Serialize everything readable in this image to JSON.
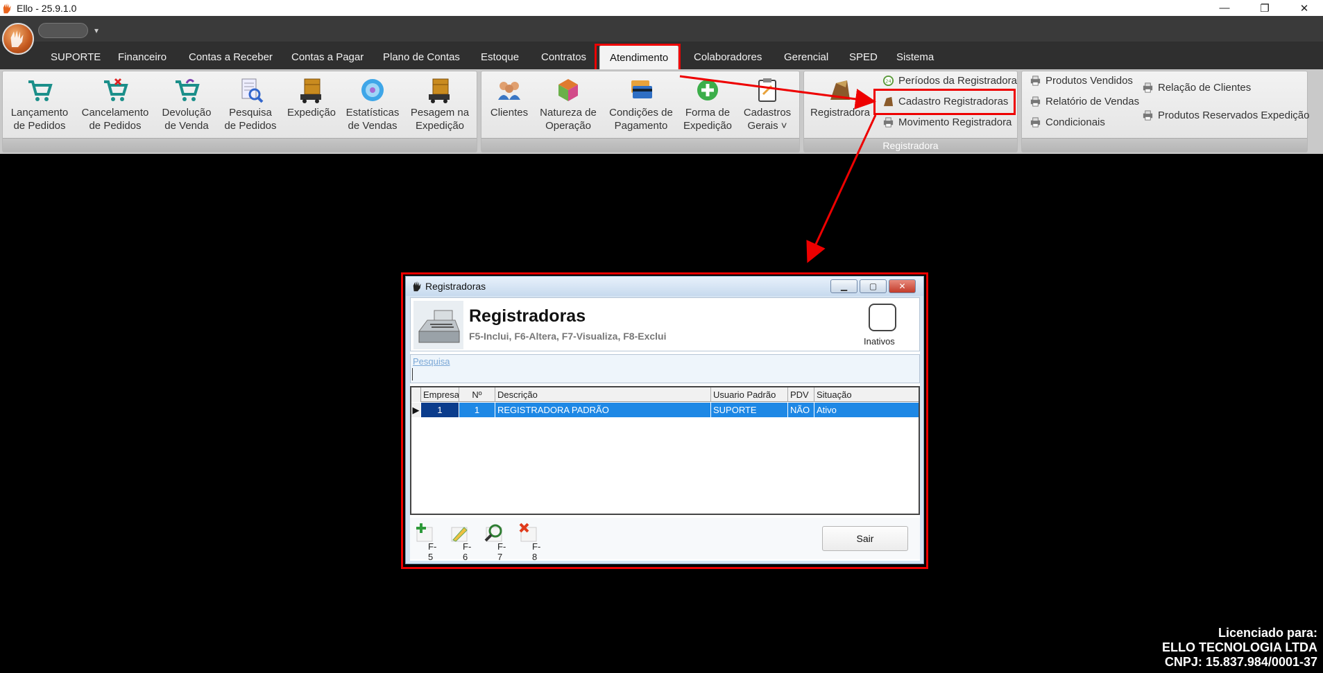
{
  "window": {
    "title": "Ello - 25.9.1.0"
  },
  "tabs": [
    {
      "label": "SUPORTE"
    },
    {
      "label": "Financeiro"
    },
    {
      "label": "Contas a Receber"
    },
    {
      "label": "Contas a Pagar"
    },
    {
      "label": "Plano de Contas"
    },
    {
      "label": "Estoque"
    },
    {
      "label": "Contratos"
    },
    {
      "label": "Atendimento"
    },
    {
      "label": "Colaboradores"
    },
    {
      "label": "Gerencial"
    },
    {
      "label": "SPED"
    },
    {
      "label": "Sistema"
    }
  ],
  "active_tab": "Atendimento",
  "ribbon": {
    "group1": [
      {
        "line1": "Lançamento",
        "line2": "de Pedidos"
      },
      {
        "line1": "Cancelamento",
        "line2": "de Pedidos"
      },
      {
        "line1": "Devolução",
        "line2": "de Venda"
      },
      {
        "line1": "Pesquisa",
        "line2": "de Pedidos"
      },
      {
        "line1": "Expedição",
        "line2": ""
      },
      {
        "line1": "Estatísticas",
        "line2": "de Vendas"
      },
      {
        "line1": "Pesagem na",
        "line2": "Expedição"
      }
    ],
    "group2": [
      {
        "line1": "Clientes",
        "line2": ""
      },
      {
        "line1": "Natureza de",
        "line2": "Operação"
      },
      {
        "line1": "Condições de",
        "line2": "Pagamento"
      },
      {
        "line1": "Forma de",
        "line2": "Expedição"
      },
      {
        "line1": "Cadastros",
        "line2": "Gerais ˅"
      }
    ],
    "registradora": {
      "big_label": "Registradora",
      "items": [
        "Períodos da Registradora",
        "Cadastro Registradoras",
        "Movimento Registradora"
      ],
      "group_label": "Registradora"
    },
    "reports": {
      "col1": [
        "Produtos Vendidos",
        "Relatório de Vendas",
        "Condicionais"
      ],
      "col2": [
        "Relação de Clientes",
        "Produtos Reservados Expedição"
      ]
    }
  },
  "dialog": {
    "title": "Registradoras",
    "header_title": "Registradoras",
    "header_subtitle": "F5-Inclui, F6-Altera, F7-Visualiza, F8-Exclui",
    "inativos_label": "Inativos",
    "search_label": "Pesquisa",
    "search_value": "",
    "columns": [
      "Empresa",
      "Nº",
      "Descrição",
      "Usuario Padrão",
      "PDV",
      "Situação"
    ],
    "rows": [
      {
        "empresa": "1",
        "numero": "1",
        "descricao": "REGISTRADORA PADRÃO",
        "usuario": "SUPORTE",
        "pdv": "NÃO",
        "situacao": "Ativo"
      }
    ],
    "footer_keys": [
      "F-5",
      "F-6",
      "F-7",
      "F-8"
    ],
    "sair_label": "Sair"
  },
  "license": {
    "line1": "Licenciado para:",
    "line2": "ELLO TECNOLOGIA LTDA",
    "line3": "CNPJ: 15.837.984/0001-37"
  },
  "colors": {
    "highlight": "#e00000",
    "selected_row": "#1e88e5",
    "ribbon_bg": "#c9c9c9"
  }
}
